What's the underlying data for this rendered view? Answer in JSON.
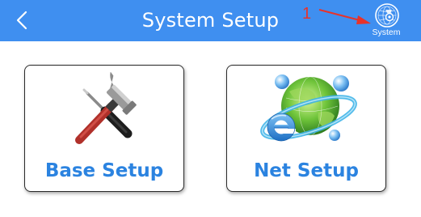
{
  "header": {
    "title": "System Setup",
    "back_icon": "chevron-left-icon",
    "background_color": "#3f8ff0"
  },
  "annotation": {
    "number": "1",
    "color": "#e8332a"
  },
  "system_button": {
    "label": "System",
    "icon": "globe-gear-icon"
  },
  "cards": {
    "base": {
      "label": "Base Setup",
      "icon": "tools-icon"
    },
    "net": {
      "label": "Net Setup",
      "icon": "internet-globe-icon"
    }
  },
  "label_color": "#2b83e0"
}
